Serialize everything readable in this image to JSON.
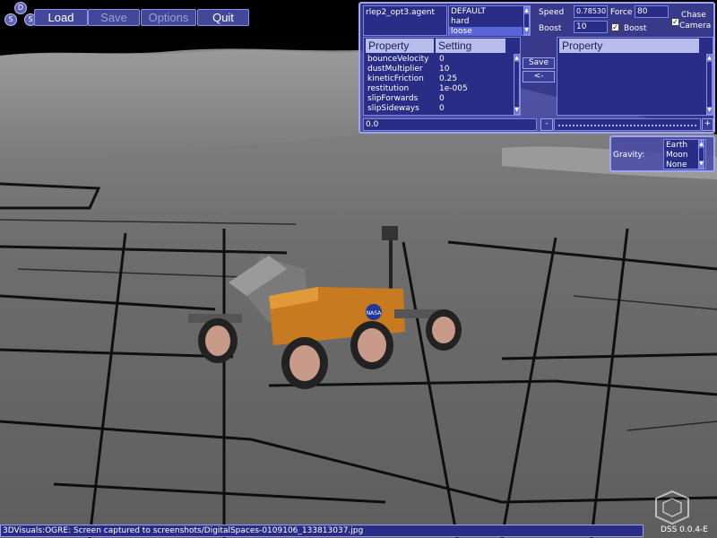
{
  "logo": {
    "letters": [
      "D",
      "S",
      "S"
    ]
  },
  "menu": {
    "load": "Load",
    "save": "Save",
    "options": "Options",
    "quit": "Quit"
  },
  "agent_panel": {
    "agent_file": "rlep2_opt3.agent",
    "presets": [
      "DEFAULT",
      "hard",
      "loose"
    ],
    "selected_preset": "loose",
    "speed_label": "Speed",
    "speed_value": "0.78530",
    "force_label": "Force",
    "force_value": "80",
    "boost_label": "Boost",
    "boost_value": "10",
    "boost_check_label": "Boost",
    "chase_label": "Chase",
    "camera_label": "Camera",
    "table_headers": {
      "property": "Property",
      "setting": "Setting",
      "right_property": "Property"
    },
    "properties": [
      {
        "name": "bounceVelocity",
        "value": "0"
      },
      {
        "name": "dustMultiplier",
        "value": "10"
      },
      {
        "name": "kineticFriction",
        "value": "0.25"
      },
      {
        "name": "restitution",
        "value": "1e-005"
      },
      {
        "name": "slipForwards",
        "value": "0"
      },
      {
        "name": "slipSideways",
        "value": "0"
      }
    ],
    "save_button": "Save",
    "arrow_button": "<-",
    "edit_value": "0.0",
    "minus_button": "-",
    "plus_button": "+"
  },
  "gravity_panel": {
    "label": "Gravity:",
    "options": [
      "Earth",
      "Moon",
      "None"
    ]
  },
  "status": {
    "message": "3DVisuals:OGRE: Screen captured to screenshots/DigitalSpaces-0109106_133813037.jpg",
    "version": "DSS 0.0.4-E"
  },
  "rover": {
    "badge": "NASA"
  }
}
